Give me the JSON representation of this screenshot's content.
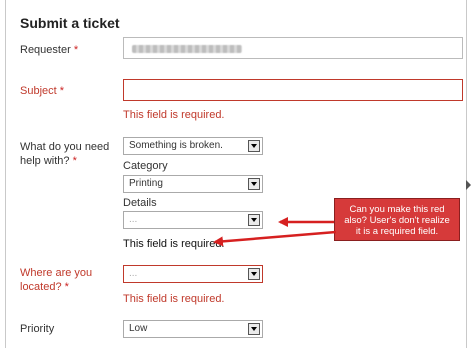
{
  "form": {
    "title": "Submit a ticket",
    "requester": {
      "label": "Requester",
      "star": "*"
    },
    "subject": {
      "label": "Subject",
      "star": "*",
      "error": "This field is required."
    },
    "help": {
      "label_line1": "What do you need",
      "label_line2": "help with?",
      "star": "*",
      "value": "Something is broken.",
      "category_label": "Category",
      "category_value": "Printing",
      "details_label": "Details",
      "details_value": "...",
      "details_error": "This field is required."
    },
    "location": {
      "label_line1": "Where are you",
      "label_line2": "located?",
      "star": "*",
      "value": "...",
      "error": "This field is required."
    },
    "priority": {
      "label": "Priority",
      "value": "Low"
    }
  },
  "annotation": {
    "line1": "Can you make this red",
    "line2": "also?  User's don't realize",
    "line3": "it is a required field.",
    "color": "#d63a3a"
  }
}
